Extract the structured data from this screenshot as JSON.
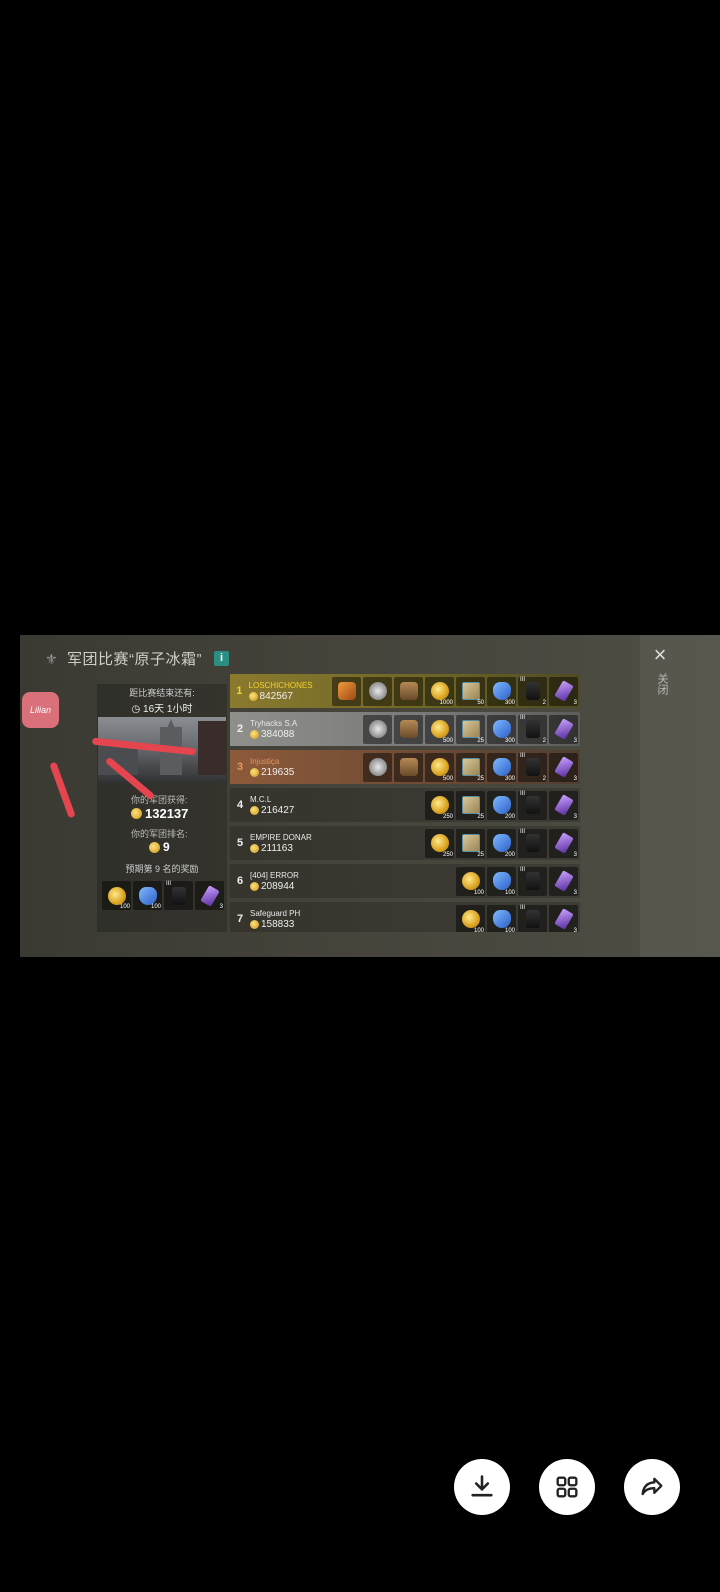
{
  "header": {
    "title": "军团比赛“原子冰霜”",
    "info_label": "i",
    "close_icon": "×",
    "close_label": "关闭"
  },
  "app_icon_text": "Lilian",
  "left_panel": {
    "time_label": "距比赛结束还有:",
    "time_value": "16天 1小时",
    "points_label": "你的军团获得:",
    "points_value": "132137",
    "rank_label": "你的军团排名:",
    "rank_value": "9",
    "reward_label": "预期第 9 名的奖励",
    "rewards": [
      {
        "icon": "coin",
        "qty": "100"
      },
      {
        "icon": "flask",
        "qty": "100"
      },
      {
        "icon": "suit",
        "qty": "",
        "roman": "III"
      },
      {
        "icon": "vial",
        "qty": "3"
      }
    ]
  },
  "leaderboard": [
    {
      "rank": "1",
      "name": "LOSCHICHONES",
      "score": "842567",
      "style": "r1",
      "rewards": [
        {
          "icon": "fox",
          "qty": ""
        },
        {
          "icon": "mask",
          "qty": ""
        },
        {
          "icon": "bag",
          "qty": ""
        },
        {
          "icon": "coin",
          "qty": "1000"
        },
        {
          "icon": "crate",
          "qty": "50"
        },
        {
          "icon": "flask",
          "qty": "300"
        },
        {
          "icon": "suit",
          "qty": "2",
          "roman": "III"
        },
        {
          "icon": "vial",
          "qty": "3"
        }
      ]
    },
    {
      "rank": "2",
      "name": "Tryhacks S.A",
      "score": "384088",
      "style": "r2",
      "rewards": [
        {
          "icon": "mask",
          "qty": ""
        },
        {
          "icon": "bag",
          "qty": ""
        },
        {
          "icon": "coin",
          "qty": "500"
        },
        {
          "icon": "crate",
          "qty": "25"
        },
        {
          "icon": "flask",
          "qty": "300"
        },
        {
          "icon": "suit",
          "qty": "2",
          "roman": "III"
        },
        {
          "icon": "vial",
          "qty": "3"
        }
      ]
    },
    {
      "rank": "3",
      "name": "Injustiça",
      "score": "219635",
      "style": "r3",
      "rewards": [
        {
          "icon": "mask",
          "qty": ""
        },
        {
          "icon": "bag",
          "qty": ""
        },
        {
          "icon": "coin",
          "qty": "500"
        },
        {
          "icon": "crate",
          "qty": "25"
        },
        {
          "icon": "flask",
          "qty": "300"
        },
        {
          "icon": "suit",
          "qty": "2",
          "roman": "III"
        },
        {
          "icon": "vial",
          "qty": "3"
        }
      ]
    },
    {
      "rank": "4",
      "name": "M.C.L",
      "score": "216427",
      "style": "",
      "rewards": [
        {
          "icon": "coin",
          "qty": "250"
        },
        {
          "icon": "crate",
          "qty": "25"
        },
        {
          "icon": "flask",
          "qty": "200"
        },
        {
          "icon": "suit",
          "qty": "",
          "roman": "III"
        },
        {
          "icon": "vial",
          "qty": "3"
        }
      ]
    },
    {
      "rank": "5",
      "name": "EMPIRE DONAR",
      "score": "211163",
      "style": "",
      "rewards": [
        {
          "icon": "coin",
          "qty": "250"
        },
        {
          "icon": "crate",
          "qty": "25"
        },
        {
          "icon": "flask",
          "qty": "200"
        },
        {
          "icon": "suit",
          "qty": "",
          "roman": "III"
        },
        {
          "icon": "vial",
          "qty": "3"
        }
      ]
    },
    {
      "rank": "6",
      "name": "[404] ERROR",
      "score": "208944",
      "style": "",
      "rewards": [
        {
          "icon": "coin",
          "qty": "100"
        },
        {
          "icon": "flask",
          "qty": "100"
        },
        {
          "icon": "suit",
          "qty": "",
          "roman": "III"
        },
        {
          "icon": "vial",
          "qty": "3"
        }
      ]
    },
    {
      "rank": "7",
      "name": "Safeguard PH",
      "score": "158833",
      "style": "",
      "rewards": [
        {
          "icon": "coin",
          "qty": "100"
        },
        {
          "icon": "flask",
          "qty": "100"
        },
        {
          "icon": "suit",
          "qty": "",
          "roman": "III"
        },
        {
          "icon": "vial",
          "qty": "3"
        }
      ]
    }
  ],
  "viewer_actions": [
    {
      "name": "download-icon"
    },
    {
      "name": "grid-icon"
    },
    {
      "name": "share-icon"
    }
  ],
  "colors": {
    "rank1": "#f2d12e",
    "rank3": "#e9935f",
    "annotation": "#e5454f",
    "info": "#2a8f82"
  }
}
